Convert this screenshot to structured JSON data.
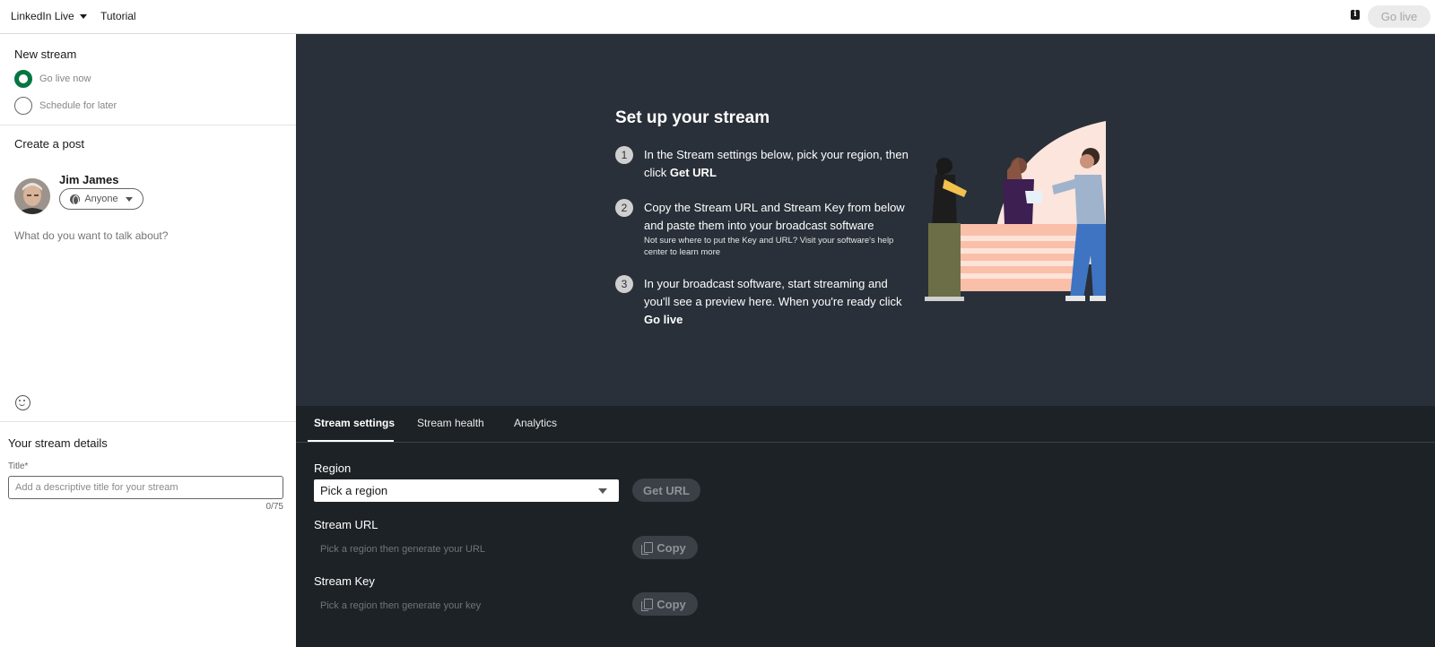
{
  "topbar": {
    "brand": "LinkedIn Live",
    "tutorial": "Tutorial",
    "info_icon": "i",
    "go_live": "Go live"
  },
  "left": {
    "new_stream_title": "New stream",
    "radio_go_live": "Go live now",
    "radio_schedule": "Schedule for later",
    "create_post_title": "Create a post",
    "user_name": "Jim James",
    "audience": "Anyone",
    "post_placeholder": "What do you want to talk about?",
    "stream_details_title": "Your stream details",
    "title_label": "Title*",
    "title_placeholder": "Add a descriptive title for your stream",
    "char_count": "0/75"
  },
  "setup": {
    "title": "Set up your stream",
    "steps": [
      {
        "num": "1",
        "text_a": "In the Stream settings below, pick your region, then click ",
        "bold": "Get URL"
      },
      {
        "num": "2",
        "text_a": "Copy the Stream URL and Stream Key from below and paste them into your broadcast software",
        "sub": "Not sure where to put the Key and URL? Visit your software's help center to learn more"
      },
      {
        "num": "3",
        "text_a": "In your broadcast software, start streaming and you'll see a preview here. When you're ready click ",
        "bold": "Go live"
      }
    ]
  },
  "tabs": {
    "settings": "Stream settings",
    "health": "Stream health",
    "analytics": "Analytics"
  },
  "settings": {
    "region_label": "Region",
    "region_value": "Pick a region",
    "get_url": "Get URL",
    "url_label": "Stream URL",
    "url_placeholder": "Pick a region then generate your URL",
    "key_label": "Stream Key",
    "key_placeholder": "Pick a region then generate your key",
    "copy": "Copy"
  },
  "colors": {
    "accent_green": "#057642",
    "stage_bg": "#293039",
    "panel_bg": "#1d2226"
  },
  "icons": [
    "chevron-down-icon",
    "info-icon",
    "globe-icon",
    "smile-icon",
    "copy-icon"
  ]
}
